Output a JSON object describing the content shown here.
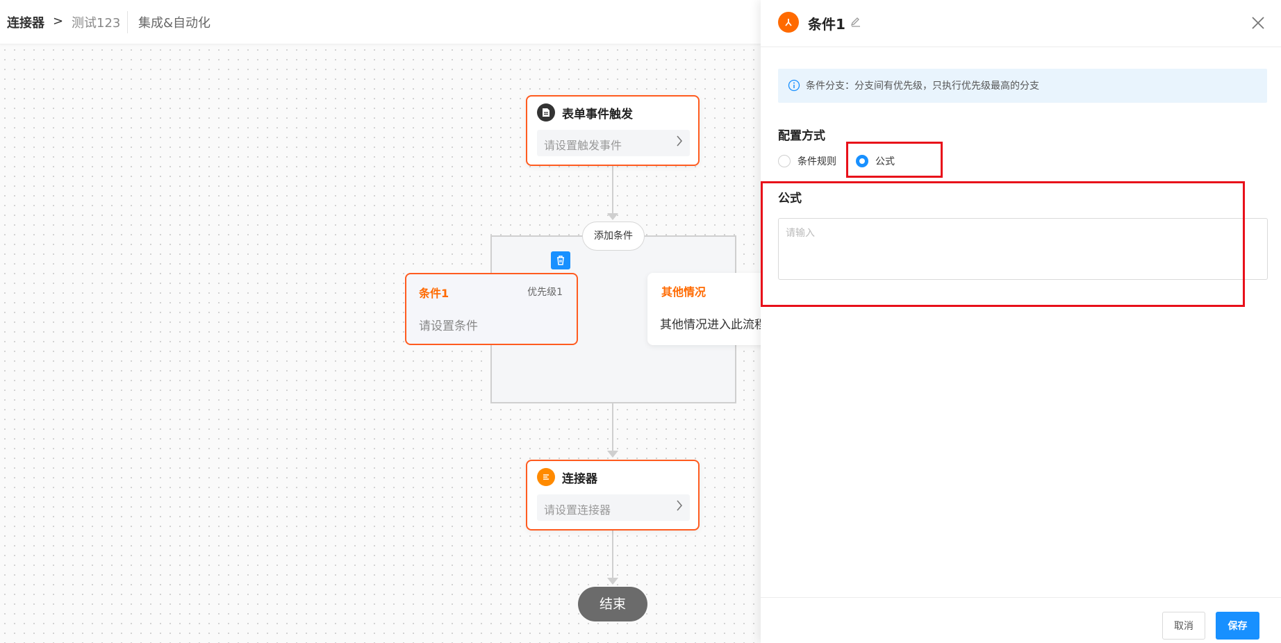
{
  "breadcrumb": {
    "root": "连接器",
    "separator": ">",
    "item2": "测试123",
    "item3": "集成&自动化"
  },
  "flow": {
    "trigger": {
      "title": "表单事件触发",
      "placeholder": "请设置触发事件",
      "icon": "document-icon"
    },
    "add_condition": "添加条件",
    "condition1": {
      "title": "条件1",
      "priority": "优先级1",
      "desc": "请设置条件"
    },
    "other": {
      "title": "其他情况",
      "desc": "其他情况进入此流程"
    },
    "connector": {
      "title": "连接器",
      "placeholder": "请设置连接器",
      "icon": "connector-icon"
    },
    "end": "结束"
  },
  "panel": {
    "title": "条件1",
    "info": "条件分支：分支间有优先级，只执行优先级最高的分支",
    "config_label": "配置方式",
    "options": [
      {
        "label": "条件规则",
        "selected": false
      },
      {
        "label": "公式",
        "selected": true
      }
    ],
    "formula_label": "公式",
    "formula_placeholder": "请输入",
    "cancel": "取消",
    "save": "保存"
  },
  "colors": {
    "accent": "#ff5b1f",
    "primary": "#1890ff",
    "highlight": "#e8101a"
  }
}
